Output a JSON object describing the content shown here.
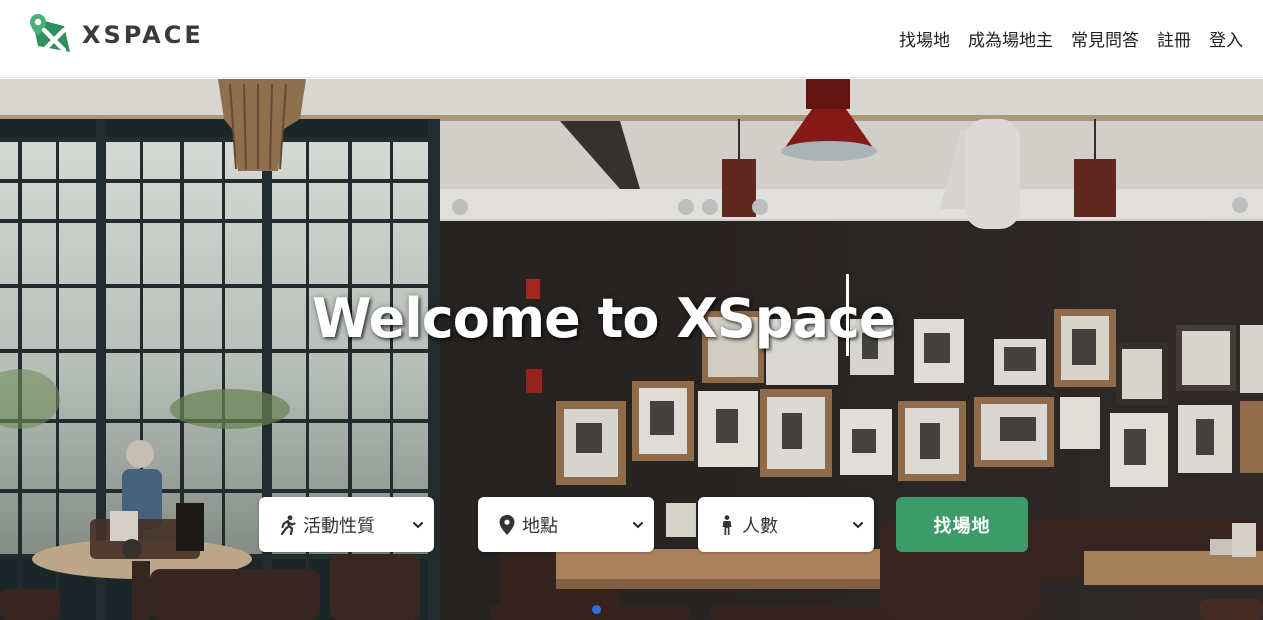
{
  "brand": {
    "name": "XSPACE"
  },
  "nav": {
    "items": [
      "找場地",
      "成為場地主",
      "常見問答",
      "註冊",
      "登入"
    ]
  },
  "hero": {
    "headline": "Welcome to XSpace"
  },
  "search": {
    "activity_type": "活動性質",
    "location": "地點",
    "people": "人數",
    "submit": "找場地"
  },
  "colors": {
    "accent": "#3d9b6a",
    "indicator": "#2f6fe0"
  }
}
